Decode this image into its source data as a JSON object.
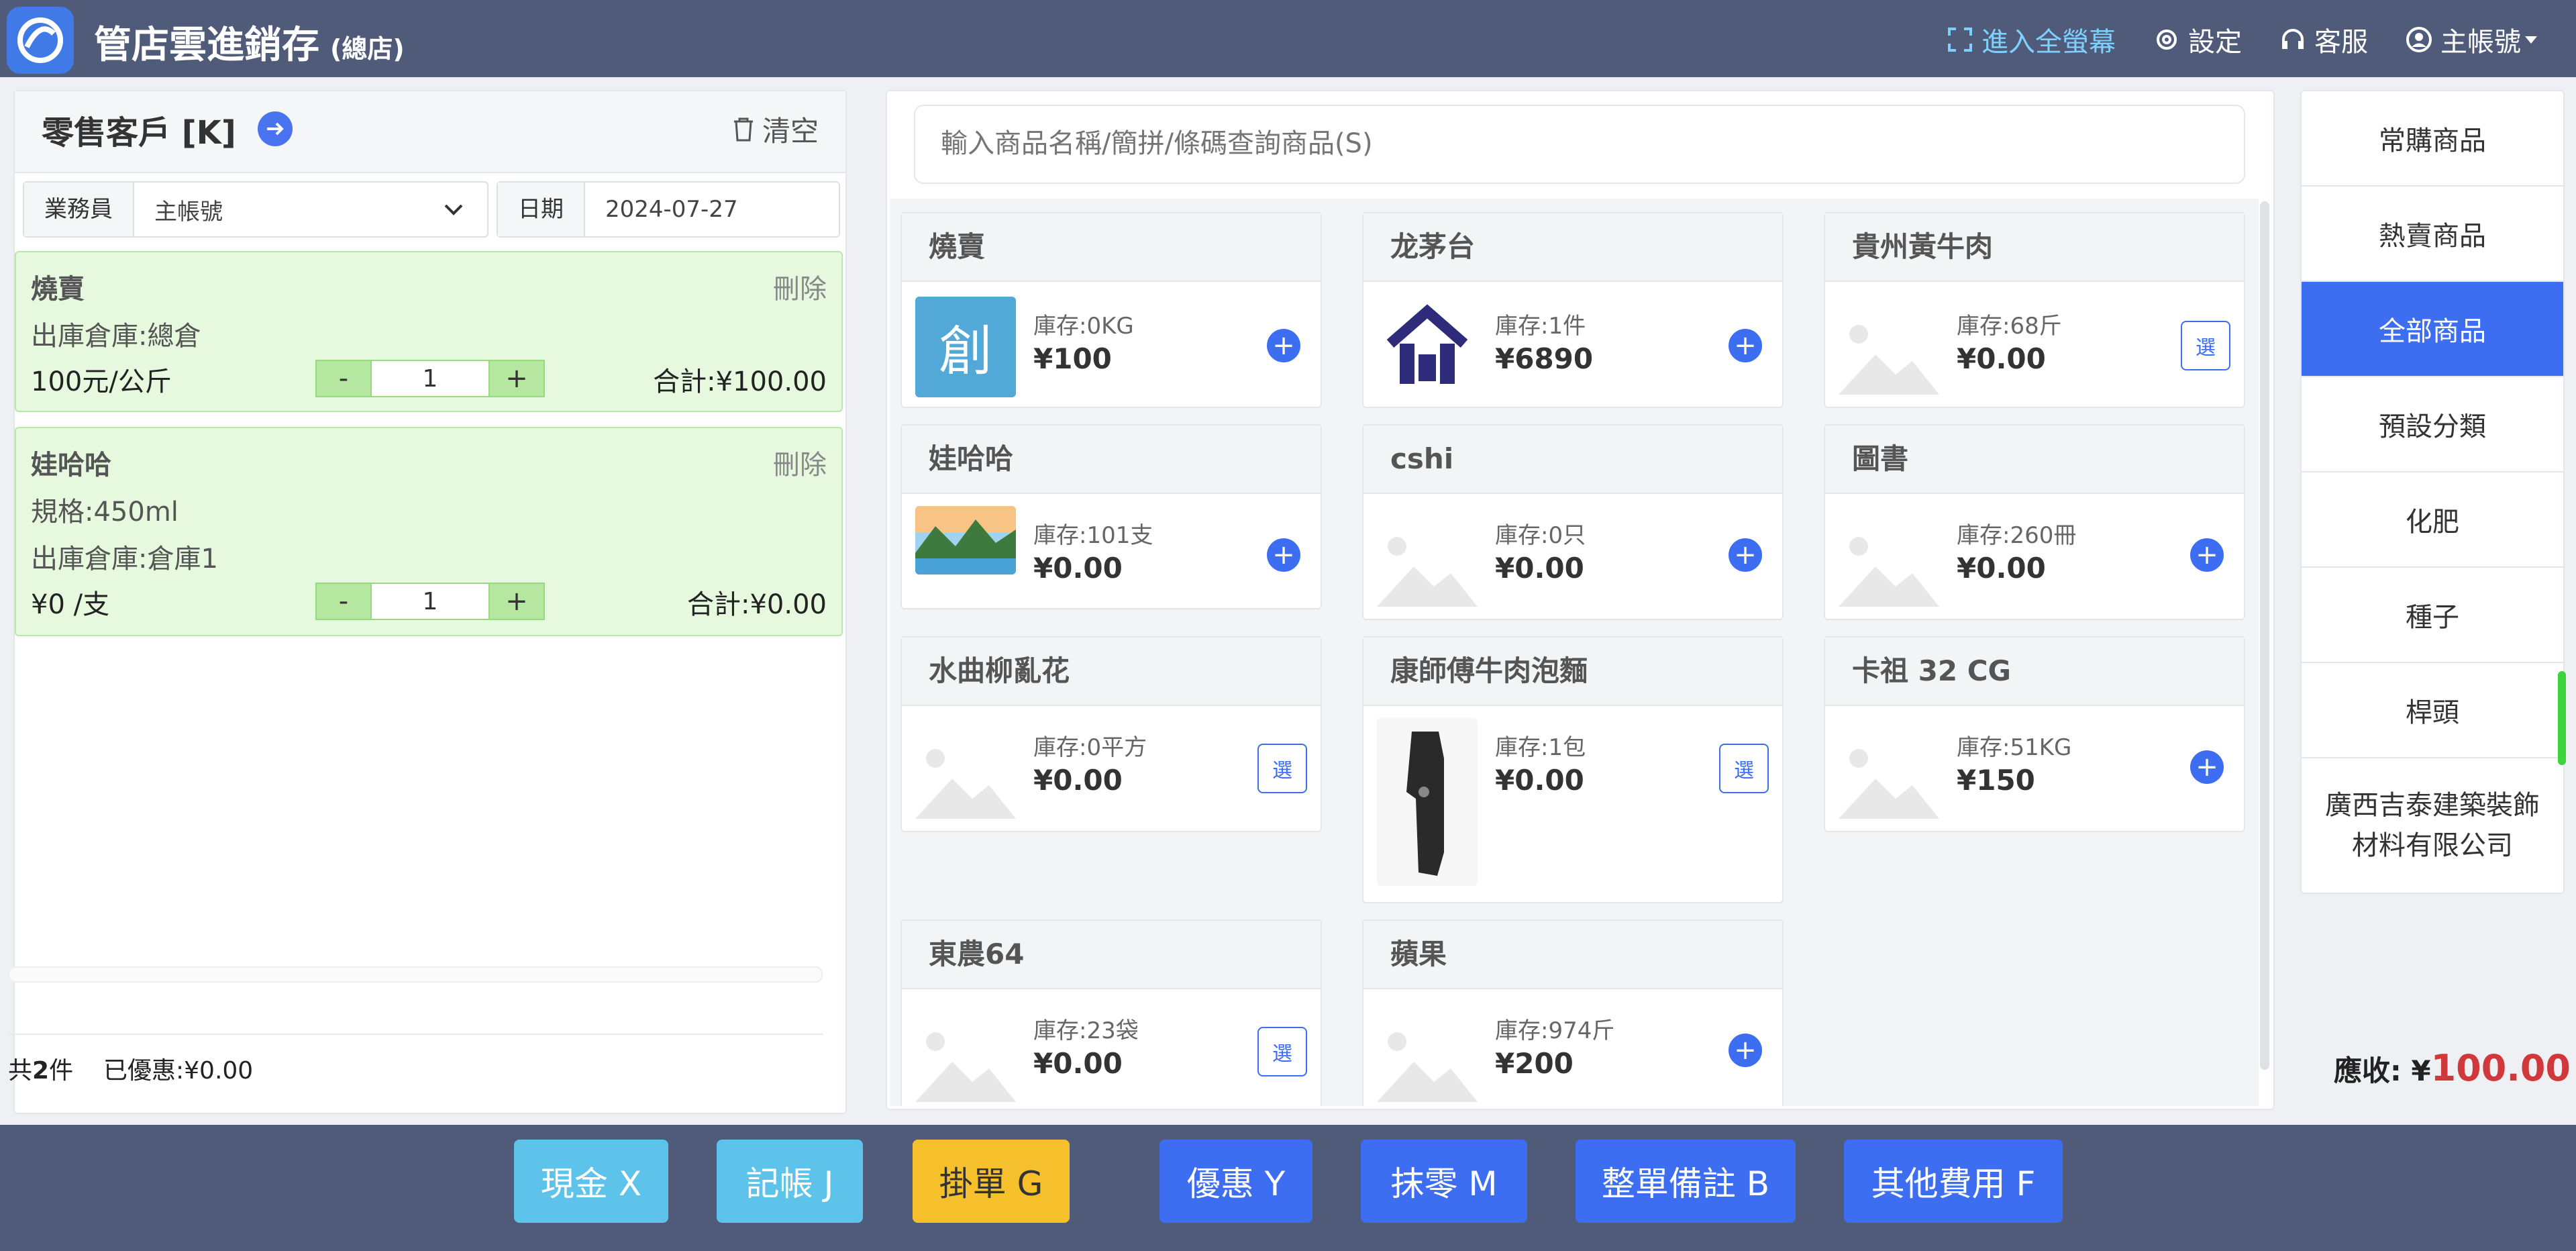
{
  "header": {
    "app_title": "管店雲進銷存",
    "store_label": "(總店)",
    "fullscreen": "進入全螢幕",
    "settings": "設定",
    "support": "客服",
    "account": "主帳號"
  },
  "customer": {
    "title": "零售客戶 [K]",
    "clear": "清空",
    "salesman_label": "業務員",
    "salesman_value": "主帳號",
    "date_label": "日期",
    "date_value": "2024-07-27"
  },
  "cart": [
    {
      "name": "燒賣",
      "delete": "刪除",
      "lines": [
        "出庫倉庫:總倉"
      ],
      "unit_price": "100元/公斤",
      "qty": "1",
      "total": "合計:¥100.00"
    },
    {
      "name": "娃哈哈",
      "delete": "刪除",
      "lines": [
        "規格:450ml",
        "出庫倉庫:倉庫1"
      ],
      "unit_price": "¥0 /支",
      "qty": "1",
      "total": "合計:¥0.00"
    }
  ],
  "summary": {
    "count_prefix": "共",
    "count": "2",
    "count_suffix": "件",
    "discount": "已優惠:¥0.00",
    "due_label": "應收:",
    "due_currency": "¥",
    "due_amount": "100.00"
  },
  "search": {
    "placeholder": "輸入商品名稱/簡拼/條碼查詢商品(S)"
  },
  "products": [
    {
      "name": "燒賣",
      "stock": "庫存:0KG",
      "price": "¥100",
      "action": "add"
    },
    {
      "name": "龙茅台",
      "stock": "庫存:1件",
      "price": "¥6890",
      "action": "add"
    },
    {
      "name": "貴州黃牛肉",
      "stock": "庫存:68斤",
      "price": "¥0.00",
      "action": "select"
    },
    {
      "name": "娃哈哈",
      "stock": "庫存:101支",
      "price": "¥0.00",
      "action": "add"
    },
    {
      "name": "cshi",
      "stock": "庫存:0只",
      "price": "¥0.00",
      "action": "add"
    },
    {
      "name": "圖書",
      "stock": "庫存:260冊",
      "price": "¥0.00",
      "action": "add"
    },
    {
      "name": "水曲柳亂花",
      "stock": "庫存:0平方",
      "price": "¥0.00",
      "action": "select"
    },
    {
      "name": "康師傅牛肉泡麵",
      "stock": "庫存:1包",
      "price": "¥0.00",
      "action": "select"
    },
    {
      "name": "卡祖 32 CG",
      "stock": "庫存:51KG",
      "price": "¥150",
      "action": "add"
    },
    {
      "name": "東農64",
      "stock": "庫存:23袋",
      "price": "¥0.00",
      "action": "select"
    },
    {
      "name": "蘋果",
      "stock": "庫存:974斤",
      "price": "¥200",
      "action": "add"
    }
  ],
  "select_label": "選",
  "logo_char": "創",
  "categories": [
    "常購商品",
    "熱賣商品",
    "全部商品",
    "預設分類",
    "化肥",
    "種子",
    "桿頭",
    "廣西吉泰建築裝飾材料有限公司"
  ],
  "active_category": "全部商品",
  "payment": [
    "現金 X",
    "記帳 J",
    "掛單 G",
    "優惠 Y",
    "抹零 M",
    "整單備註 B",
    "其他費用 F"
  ],
  "colors": {
    "topbar": "#4f5b78",
    "accent": "#3d6df0",
    "cash": "#5ec3ea",
    "hold": "#f5c02c",
    "due": "#d0393b",
    "cart_bg": "#e6f9df"
  }
}
